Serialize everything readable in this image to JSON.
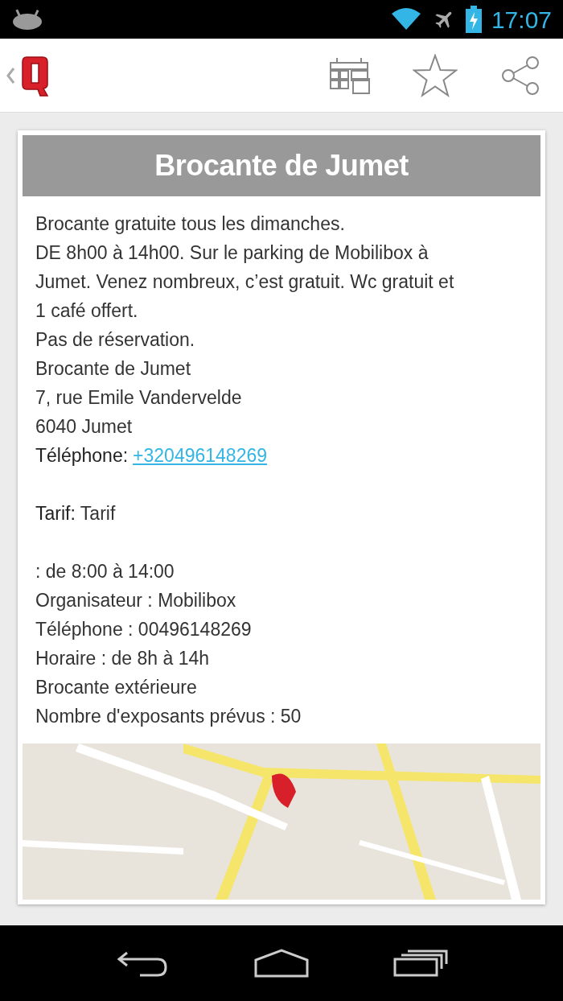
{
  "status_bar": {
    "time": "17:07"
  },
  "title": "Brocante de Jumet",
  "lines": [
    {
      "kind": "text",
      "text": "Brocante gratuite tous les dimanches."
    },
    {
      "kind": "text",
      "text": "DE 8h00 à 14h00. Sur le parking de Mobilibox à"
    },
    {
      "kind": "text",
      "text": "Jumet. Venez nombreux, c’est gratuit. Wc gratuit et"
    },
    {
      "kind": "text",
      "text": "1 café offert."
    },
    {
      "kind": "text",
      "text": "Pas de réservation."
    },
    {
      "kind": "text",
      "text": "Brocante de Jumet"
    },
    {
      "kind": "text",
      "text": "7, rue Emile Vandervelde"
    },
    {
      "kind": "text",
      "text": "6040 Jumet"
    },
    {
      "kind": "link",
      "label": "Téléphone:",
      "text": "+320496148269"
    },
    {
      "kind": "gap"
    },
    {
      "kind": "labeled",
      "label": "Tarif:",
      "text": "Tarif"
    },
    {
      "kind": "gap"
    },
    {
      "kind": "text",
      "text": ": de 8:00 à 14:00"
    },
    {
      "kind": "text",
      "text": "Organisateur : Mobilibox"
    },
    {
      "kind": "text",
      "text": "Téléphone : 00496148269"
    },
    {
      "kind": "text",
      "text": "Horaire : de 8h à 14h"
    },
    {
      "kind": "text",
      "text": "Brocante extérieure"
    },
    {
      "kind": "text",
      "text": "Nombre d'exposants prévus : 50"
    }
  ]
}
